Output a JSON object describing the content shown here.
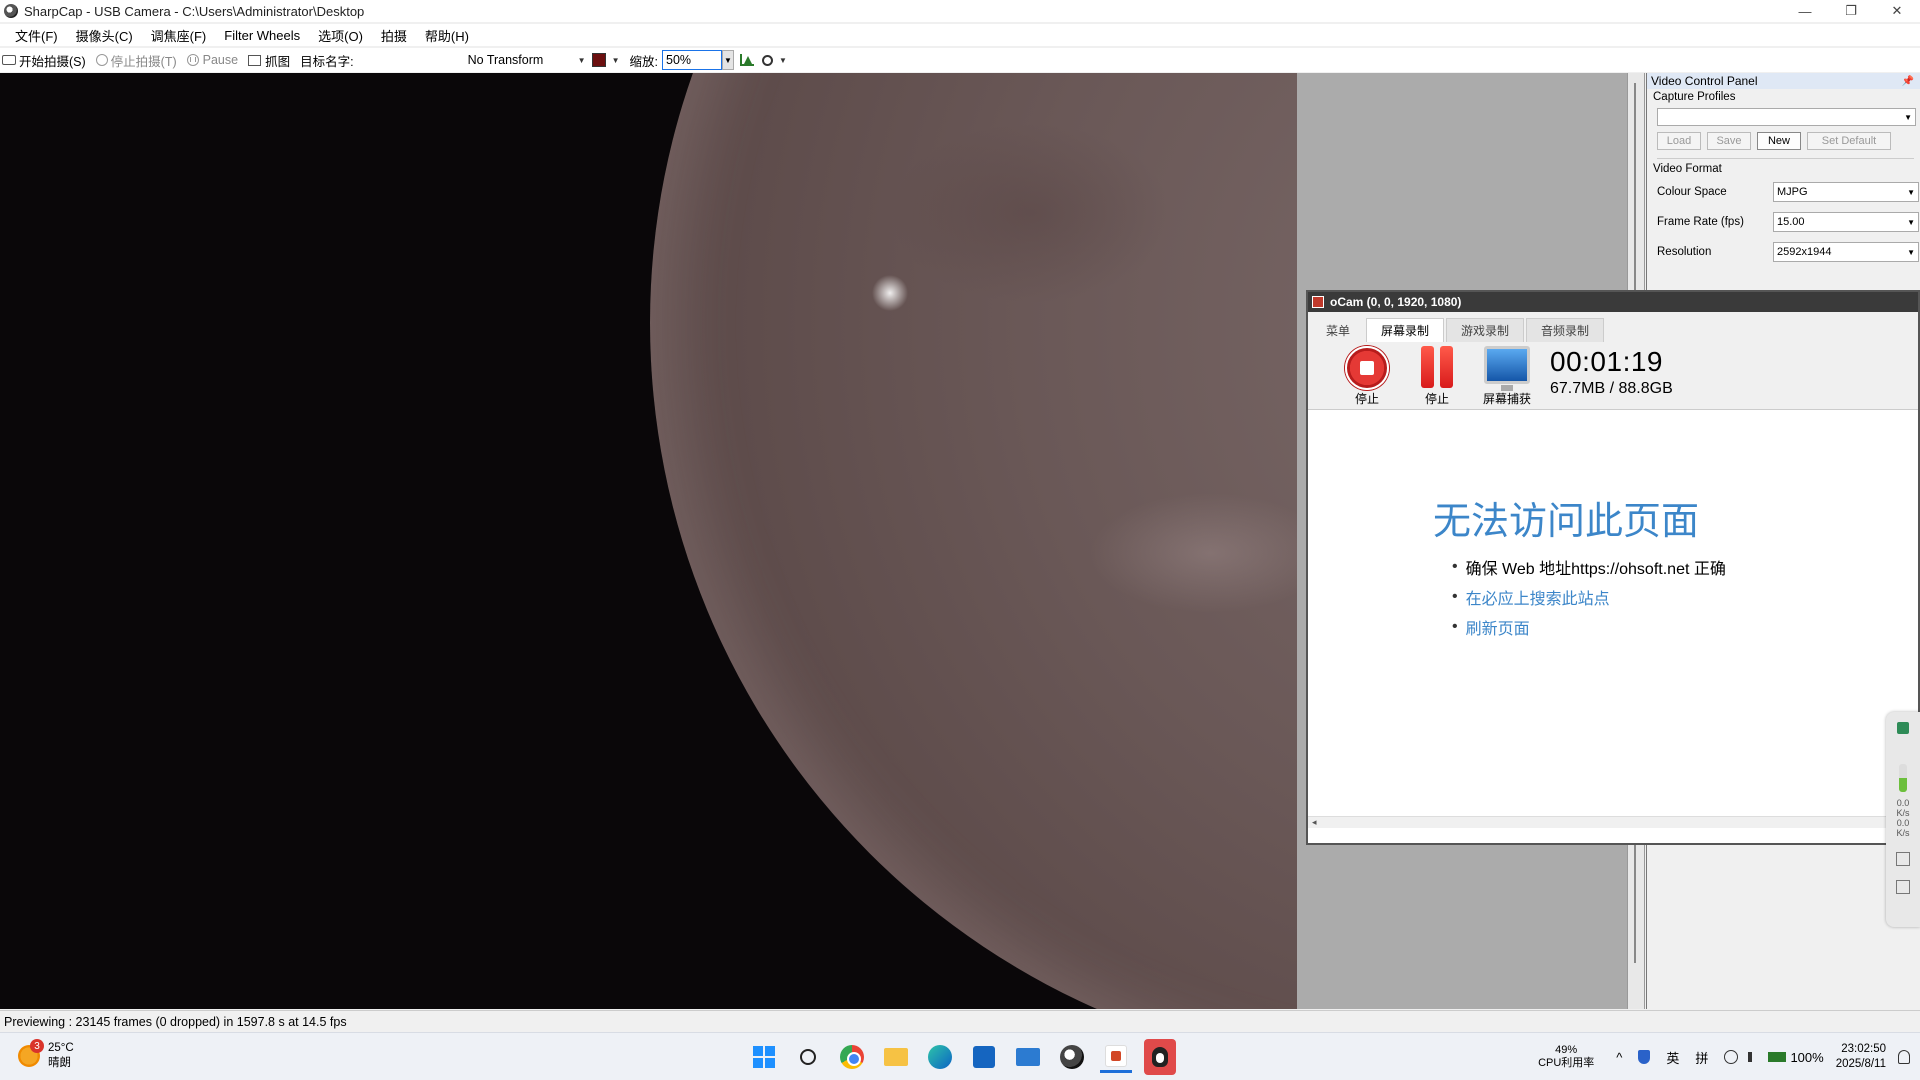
{
  "window": {
    "title": "SharpCap - USB Camera - C:\\Users\\Administrator\\Desktop",
    "minimize": "—",
    "maximize": "❐",
    "close": "✕"
  },
  "menu": [
    "文件(F)",
    "摄像头(C)",
    "调焦座(F)",
    "Filter Wheels",
    "选项(O)",
    "拍摄",
    "帮助(H)"
  ],
  "toolbar": {
    "start_capture": "开始拍摄(S)",
    "stop_capture": "停止拍摄(T)",
    "pause": "Pause",
    "grab": "抓图",
    "target_name_label": "目标名字:",
    "transform": "No Transform",
    "zoom_label": "缩放:",
    "zoom_value": "50%"
  },
  "control_panel": {
    "title": "Video Control Panel",
    "capture_profiles": {
      "label": "Capture Profiles",
      "load": "Load",
      "save": "Save",
      "new": "New",
      "set_default": "Set Default"
    },
    "video_format": {
      "label": "Video Format",
      "colour_space_label": "Colour Space",
      "colour_space": "MJPG",
      "frame_rate_label": "Frame Rate (fps)",
      "frame_rate": "15.00",
      "resolution_label": "Resolution",
      "resolution": "2592x1944"
    }
  },
  "ocam": {
    "title": "oCam (0, 0, 1920, 1080)",
    "tabs": [
      "菜单",
      "屏幕录制",
      "游戏录制",
      "音频录制"
    ],
    "selected_tab": "屏幕录制",
    "stop_label": "停止",
    "pause_label": "停止",
    "capture_label": "屏幕捕获",
    "elapsed": "00:01:19",
    "size": "67.7MB / 88.8GB",
    "error_title": "无法访问此页面",
    "error_items": [
      "确保 Web 地址https://ohsoft.net 正确",
      "在必应上搜索此站点",
      "刷新页面"
    ]
  },
  "side_widget": {
    "speed_up": "0.0",
    "speed_down": "0.0",
    "unit": "K/s"
  },
  "status": "Previewing : 23145 frames (0 dropped) in 1597.8 s at 14.5 fps",
  "taskbar": {
    "weather_badge": "3",
    "temperature": "25°C",
    "weather": "晴朗",
    "cpu_percent": "49%",
    "cpu_label": "CPU利用率",
    "ime_lang": "英",
    "ime_mode": "拼",
    "battery": "100%",
    "time": "23:02:50",
    "date": "2025/8/11"
  },
  "colors": {
    "accent": "#1e6fd9",
    "link": "#3c86c9",
    "record_red": "#e53935"
  }
}
